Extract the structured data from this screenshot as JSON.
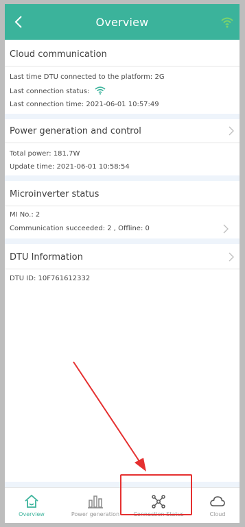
{
  "header": {
    "title": "Overview",
    "back_icon": "chevron-left-icon",
    "status_icon": "wifi-icon",
    "bg_color": "#3bb39b"
  },
  "cloud": {
    "title": "Cloud communication",
    "line1": "Last time DTU connected to the platform: 2G",
    "line2": "Last connection status:",
    "status_icon": "wifi-icon",
    "line3": "Last connection time: 2021-06-01 10:57:49"
  },
  "power": {
    "title": "Power generation and control",
    "total": "Total power: 181.7W",
    "update": "Update time: 2021-06-01 10:58:54"
  },
  "micro": {
    "title": "Microinverter status",
    "count": "MI No.: 2",
    "comm": "Communication succeeded: 2 , Offline: 0"
  },
  "dtu": {
    "title": "DTU Information",
    "id": "DTU ID: 10F761612332"
  },
  "tabs": [
    {
      "label": "Overview",
      "icon": "home-icon",
      "active": true
    },
    {
      "label": "Power generation",
      "icon": "bar-chart-icon",
      "active": false
    },
    {
      "label": "Connection Status",
      "icon": "network-icon",
      "active": false
    },
    {
      "label": "Cloud",
      "icon": "cloud-icon",
      "active": false
    }
  ],
  "annotation": {
    "arrow_color": "#e53030",
    "highlight_color": "#e53030"
  }
}
